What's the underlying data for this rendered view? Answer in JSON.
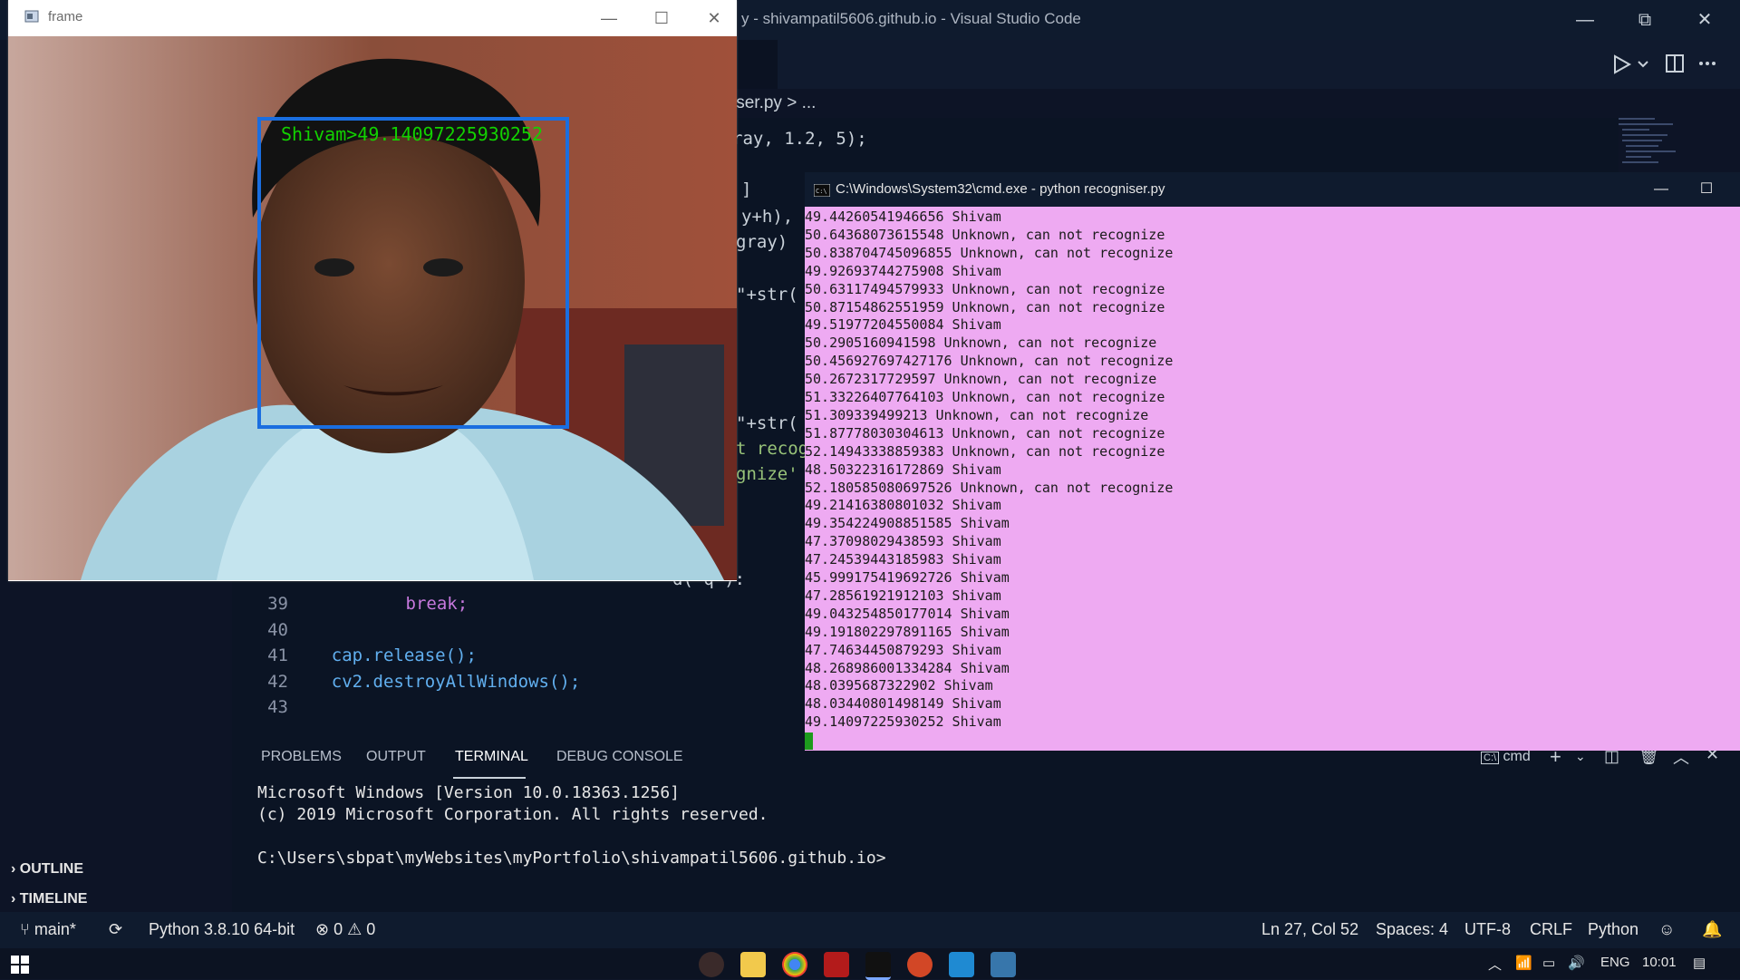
{
  "vscode": {
    "title": "y - shivampatil5606.github.io - Visual Studio Code",
    "breadcrumb": "iser.py > ...",
    "window_controls": {
      "minimize": "—",
      "restore": "⧉",
      "close": "✕"
    }
  },
  "editor": {
    "partial_lines": [
      {
        "text": "ray, 1.2, 5);"
      },
      {
        "text": "]"
      },
      {
        "text": "y+h),"
      },
      {
        "text": "gray)"
      },
      {
        "text": "\"+str("
      },
      {
        "text": "\"+str("
      },
      {
        "text": "t recog"
      },
      {
        "text": "gnize'"
      }
    ],
    "lines": [
      {
        "num": "39",
        "code": "        break;"
      },
      {
        "num": "40",
        "code": ""
      },
      {
        "num": "41",
        "code": "    cap.release();"
      },
      {
        "num": "42",
        "code": "    cv2.destroyAllWindows();"
      },
      {
        "num": "43",
        "code": ""
      }
    ],
    "partial_line_38": "d('q'):"
  },
  "sidebar": {
    "outline": "OUTLINE",
    "timeline": "TIMELINE"
  },
  "panel": {
    "tabs": [
      "PROBLEMS",
      "OUTPUT",
      "TERMINAL",
      "DEBUG CONSOLE"
    ],
    "active_tab": "TERMINAL",
    "terminal_lines": [
      "Microsoft Windows [Version 10.0.18363.1256]",
      "(c) 2019 Microsoft Corporation. All rights reserved.",
      "",
      "C:\\Users\\sbpat\\myWebsites\\myPortfolio\\shivampatil5606.github.io>"
    ],
    "terminal_shell": "cmd"
  },
  "statusbar": {
    "branch": "main*",
    "python": "Python 3.8.10 64-bit",
    "errors": "0",
    "warnings": "0",
    "position": "Ln 27, Col 52",
    "spaces": "Spaces: 4",
    "encoding": "UTF-8",
    "eol": "CRLF",
    "language": "Python"
  },
  "taskbar": {
    "lang": "ENG",
    "time": "10:01"
  },
  "frame_window": {
    "title": "frame",
    "label": "Shivam>49.14097225930252",
    "box_color": "#1a6ee0",
    "label_color": "#12d100"
  },
  "cmd_window": {
    "title": "C:\\Windows\\System32\\cmd.exe - python  recogniser.py",
    "lines": [
      "49.44260541946656 Shivam",
      "50.64368073615548 Unknown, can not recognize",
      "50.838704745096855 Unknown, can not recognize",
      "49.92693744275908 Shivam",
      "50.63117494579933 Unknown, can not recognize",
      "50.87154862551959 Unknown, can not recognize",
      "49.51977204550084 Shivam",
      "50.2905160941598 Unknown, can not recognize",
      "50.456927697427176 Unknown, can not recognize",
      "50.2672317729597 Unknown, can not recognize",
      "51.33226407764103 Unknown, can not recognize",
      "51.309339499213 Unknown, can not recognize",
      "51.87778030304613 Unknown, can not recognize",
      "52.14943338859383 Unknown, can not recognize",
      "48.50322316172869 Shivam",
      "52.180585080697526 Unknown, can not recognize",
      "49.21416380801032 Shivam",
      "49.354224908851585 Shivam",
      "47.37098029438593 Shivam",
      "47.24539443185983 Shivam",
      "45.99917541969272​6 Shivam",
      "47.28561921912103 Shivam",
      "49.043254850177014 Shivam",
      "49.191802297891165 Shivam",
      "47.74634450879293 Shivam",
      "48.268986001334284 Shivam",
      "48.0395687322902 Shivam",
      "48.03440801498149 Shivam",
      "49.14097225930252 Shivam"
    ],
    "background": "#eeaaf2"
  }
}
